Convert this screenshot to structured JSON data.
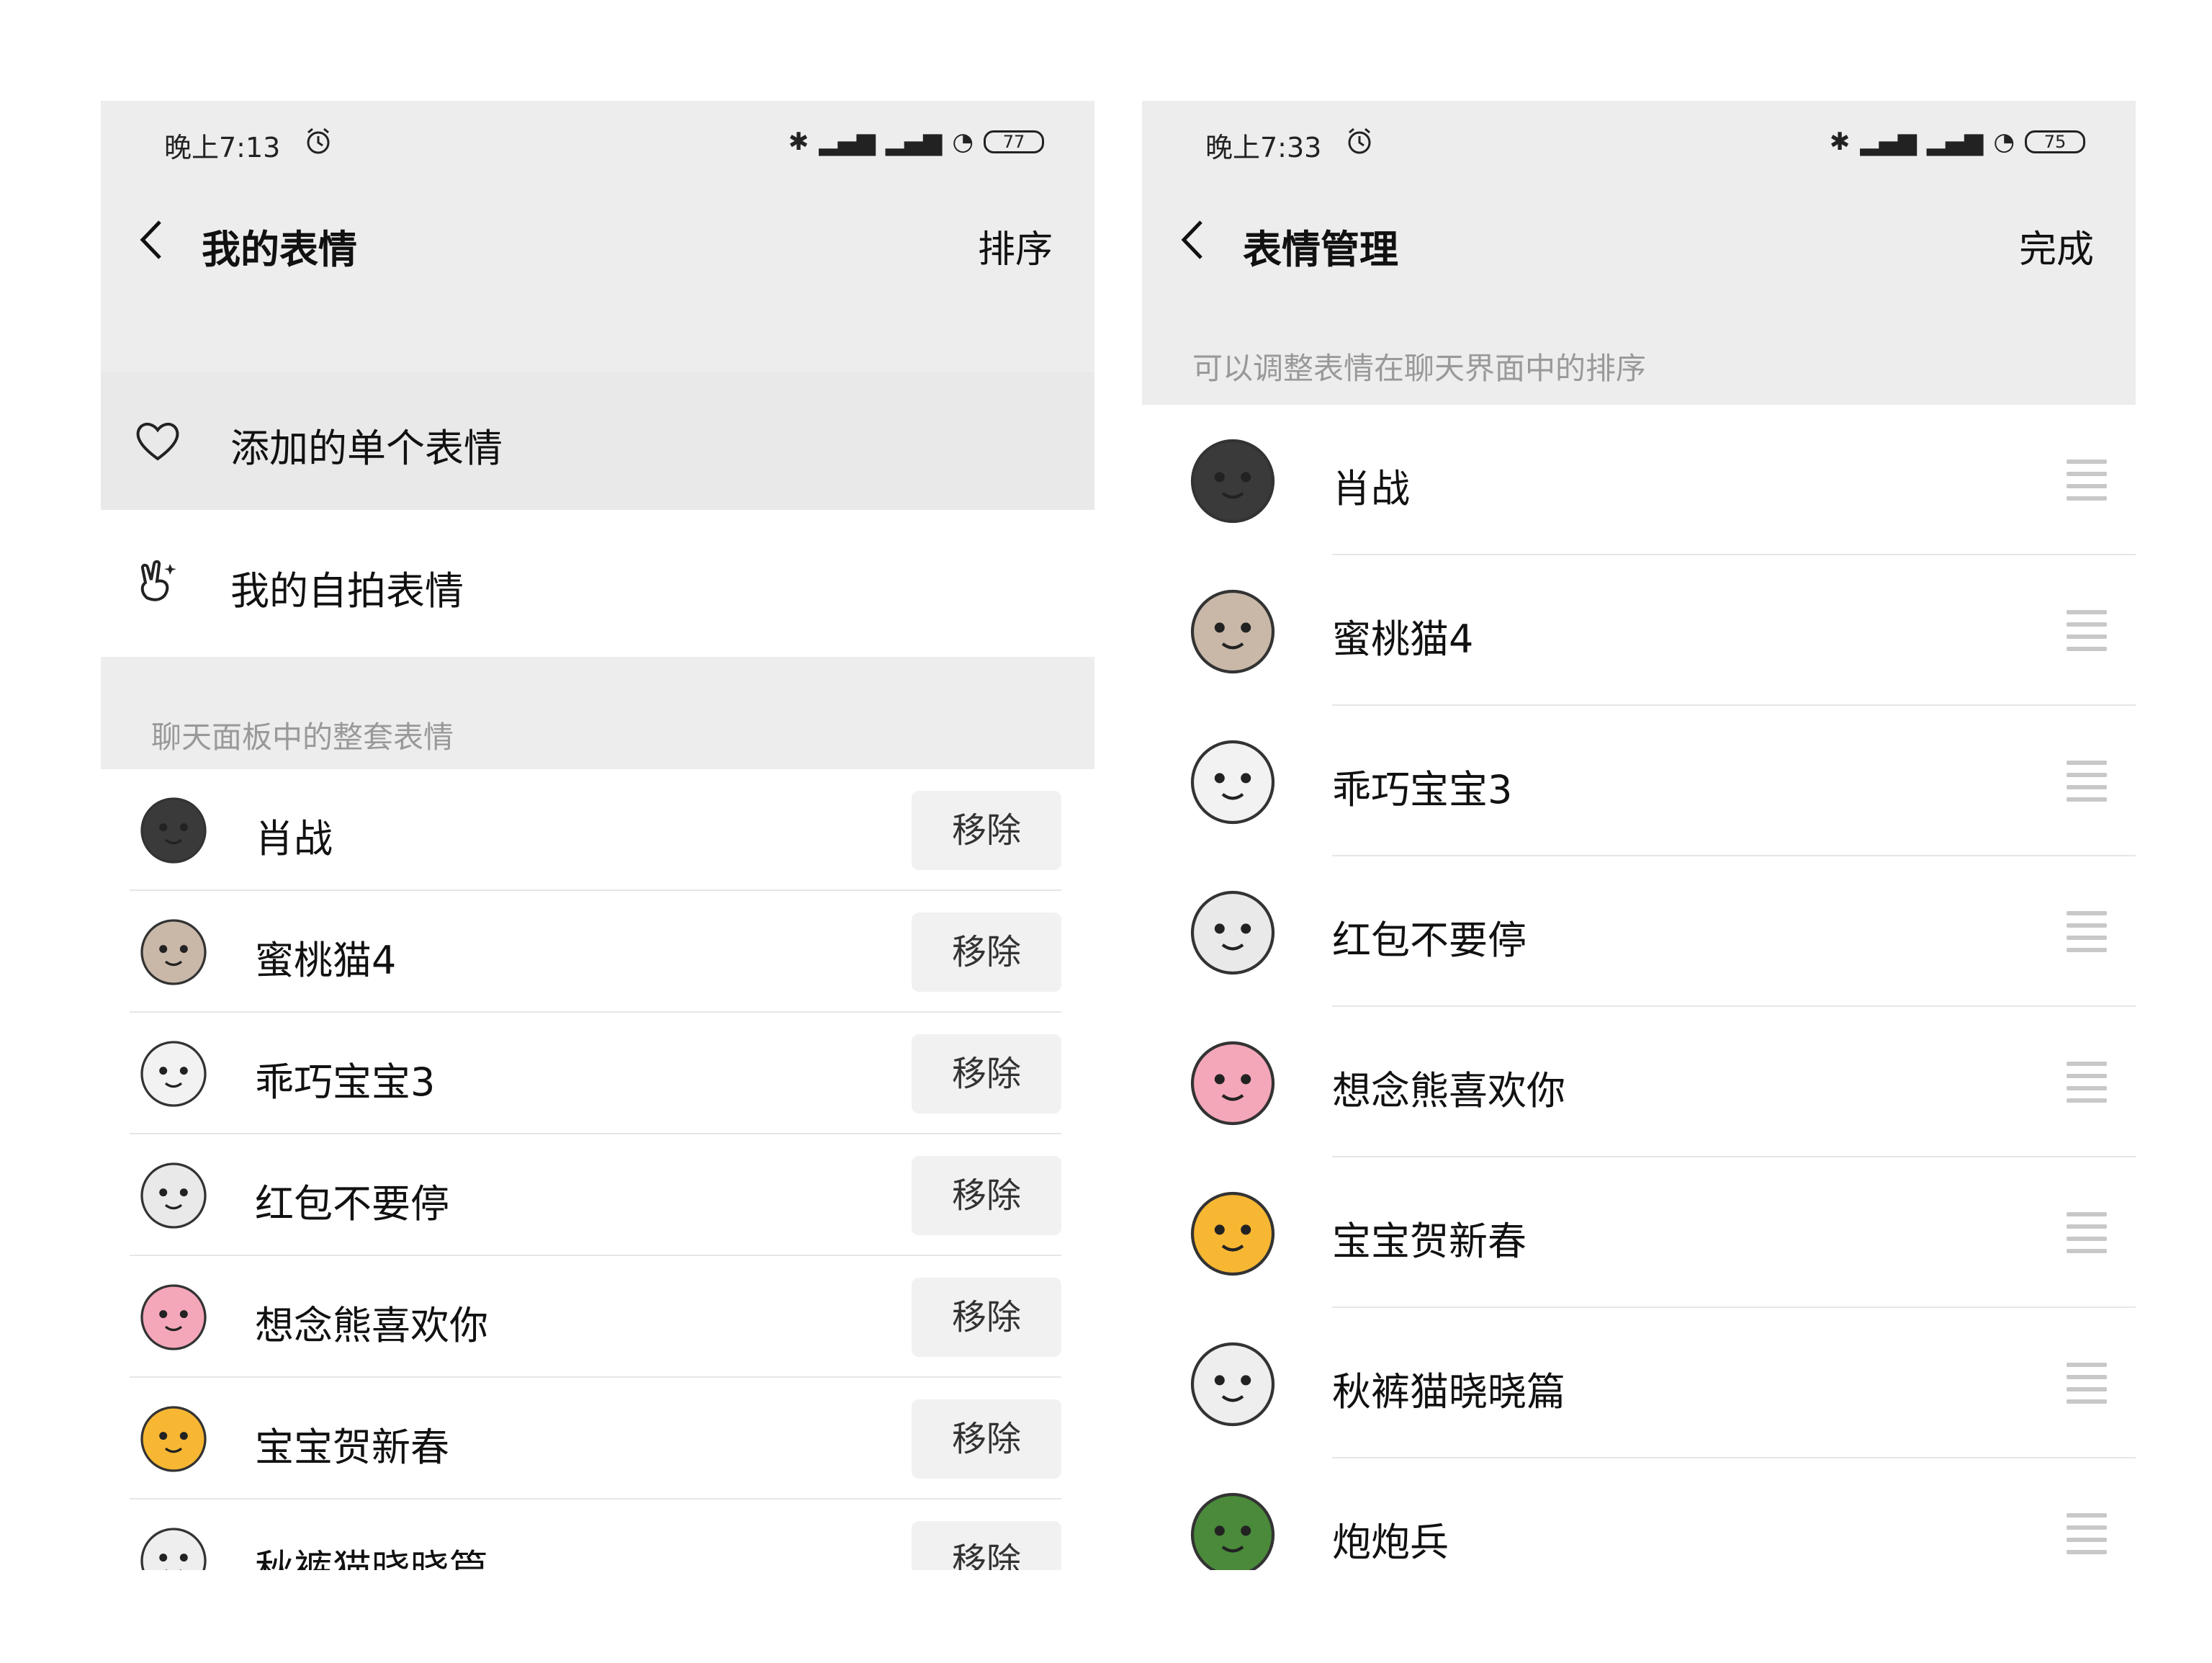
{
  "left_screen": {
    "status": {
      "time": "晚上7:13",
      "battery": "77"
    },
    "nav": {
      "title": "我的表情",
      "action": "排序"
    },
    "menu": [
      {
        "label": "添加的单个表情",
        "icon": "heart-icon",
        "selected": true
      },
      {
        "label": "我的自拍表情",
        "icon": "selfie-hand-icon",
        "selected": false
      }
    ],
    "section_label": "聊天面板中的整套表情",
    "remove_label": "移除",
    "packs": [
      {
        "name": "肖战",
        "thumb_color": "#3a3a3a"
      },
      {
        "name": "蜜桃猫4",
        "thumb_color": "#c9b8a8"
      },
      {
        "name": "乖巧宝宝3",
        "thumb_color": "#f2f2f2"
      },
      {
        "name": "红包不要停",
        "thumb_color": "#e9e9e9"
      },
      {
        "name": "想念熊喜欢你",
        "thumb_color": "#f4a7b9"
      },
      {
        "name": "宝宝贺新春",
        "thumb_color": "#f7b733"
      },
      {
        "name": "秋裤猫晓晓篇",
        "thumb_color": "#eeeeee"
      }
    ]
  },
  "right_screen": {
    "status": {
      "time": "晚上7:33",
      "battery": "75"
    },
    "nav": {
      "title": "表情管理",
      "action": "完成"
    },
    "hint": "可以调整表情在聊天界面中的排序",
    "packs": [
      {
        "name": "肖战",
        "thumb_color": "#3a3a3a"
      },
      {
        "name": "蜜桃猫4",
        "thumb_color": "#c9b8a8"
      },
      {
        "name": "乖巧宝宝3",
        "thumb_color": "#f2f2f2"
      },
      {
        "name": "红包不要停",
        "thumb_color": "#e9e9e9"
      },
      {
        "name": "想念熊喜欢你",
        "thumb_color": "#f4a7b9"
      },
      {
        "name": "宝宝贺新春",
        "thumb_color": "#f7b733"
      },
      {
        "name": "秋裤猫晓晓篇",
        "thumb_color": "#eeeeee"
      },
      {
        "name": "炮炮兵",
        "thumb_color": "#4a8a3a"
      }
    ]
  }
}
